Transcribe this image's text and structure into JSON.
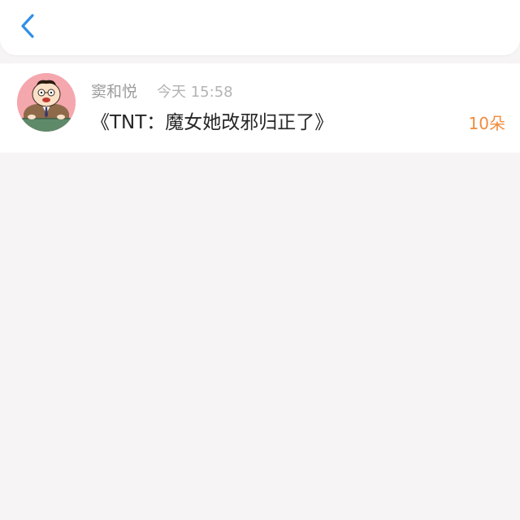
{
  "header": {
    "back_icon": "chevron-left-icon",
    "accent_color": "#2f8fe8"
  },
  "message": {
    "avatar_icon": "cartoon-avatar-icon",
    "sender": "窦和悦",
    "time": "今天 15:58",
    "title": "《TNT：魔女她改邪归正了》",
    "count": "10朵",
    "count_color": "#f08c3e"
  }
}
